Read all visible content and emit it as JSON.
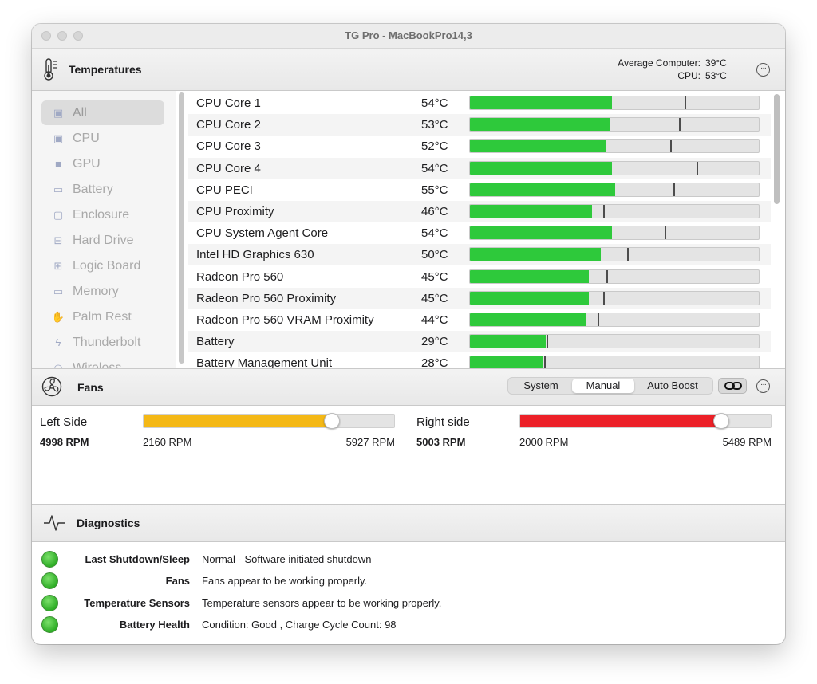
{
  "window": {
    "title": "TG Pro - MacBookPro14,3"
  },
  "temperatures": {
    "header": "Temperatures",
    "average_label": "Average Computer:",
    "average_value": "39°C",
    "cpu_label": "CPU:",
    "cpu_value": "53°C"
  },
  "sidebar": {
    "items": [
      {
        "label": "All",
        "icon": "chip-outline-icon",
        "selected": true
      },
      {
        "label": "CPU",
        "icon": "cpu-icon"
      },
      {
        "label": "GPU",
        "icon": "gpu-icon"
      },
      {
        "label": "Battery",
        "icon": "battery-icon"
      },
      {
        "label": "Enclosure",
        "icon": "enclosure-icon"
      },
      {
        "label": "Hard Drive",
        "icon": "hard-drive-icon"
      },
      {
        "label": "Logic Board",
        "icon": "logic-board-icon"
      },
      {
        "label": "Memory",
        "icon": "memory-icon"
      },
      {
        "label": "Palm Rest",
        "icon": "palm-rest-icon"
      },
      {
        "label": "Thunderbolt",
        "icon": "thunderbolt-icon"
      },
      {
        "label": "Wireless",
        "icon": "wireless-icon"
      }
    ]
  },
  "sensors": [
    {
      "name": "CPU Core 1",
      "temp": "54°C",
      "level": 0.49,
      "max": 0.74
    },
    {
      "name": "CPU Core 2",
      "temp": "53°C",
      "level": 0.48,
      "max": 0.72
    },
    {
      "name": "CPU Core 3",
      "temp": "52°C",
      "level": 0.47,
      "max": 0.69
    },
    {
      "name": "CPU Core 4",
      "temp": "54°C",
      "level": 0.49,
      "max": 0.78
    },
    {
      "name": "CPU PECI",
      "temp": "55°C",
      "level": 0.5,
      "max": 0.7
    },
    {
      "name": "CPU Proximity",
      "temp": "46°C",
      "level": 0.42,
      "max": 0.46
    },
    {
      "name": "CPU System Agent Core",
      "temp": "54°C",
      "level": 0.49,
      "max": 0.67
    },
    {
      "name": "Intel HD Graphics 630",
      "temp": "50°C",
      "level": 0.45,
      "max": 0.54
    },
    {
      "name": "Radeon Pro 560",
      "temp": "45°C",
      "level": 0.41,
      "max": 0.47
    },
    {
      "name": "Radeon Pro 560 Proximity",
      "temp": "45°C",
      "level": 0.41,
      "max": 0.46
    },
    {
      "name": "Radeon Pro 560 VRAM Proximity",
      "temp": "44°C",
      "level": 0.4,
      "max": 0.44
    },
    {
      "name": "Battery",
      "temp": "29°C",
      "level": 0.26,
      "max": 0.265
    },
    {
      "name": "Battery Management Unit",
      "temp": "28°C",
      "level": 0.25,
      "max": 0.255
    }
  ],
  "fans": {
    "header": "Fans",
    "modes": [
      "System",
      "Manual",
      "Auto Boost"
    ],
    "active_mode": "Manual",
    "left": {
      "name": "Left Side",
      "rpm": "4998 RPM",
      "min": "2160 RPM",
      "max": "5927 RPM",
      "level": 0.75,
      "color": "#f4b816"
    },
    "right": {
      "name": "Right side",
      "rpm": "5003 RPM",
      "min": "2000 RPM",
      "max": "5489 RPM",
      "level": 0.8,
      "color": "#ec2027"
    }
  },
  "diagnostics": {
    "header": "Diagnostics",
    "rows": [
      {
        "label": "Last Shutdown/Sleep",
        "value": "Normal - Software initiated shutdown"
      },
      {
        "label": "Fans",
        "value": "Fans appear to be working properly."
      },
      {
        "label": "Temperature Sensors",
        "value": "Temperature sensors appear to be working properly."
      },
      {
        "label": "Battery Health",
        "value": "Condition: Good , Charge Cycle Count: 98"
      }
    ]
  },
  "colors": {
    "bar_fill": "#2ec93b",
    "status_ok": "#3cbf2e"
  }
}
